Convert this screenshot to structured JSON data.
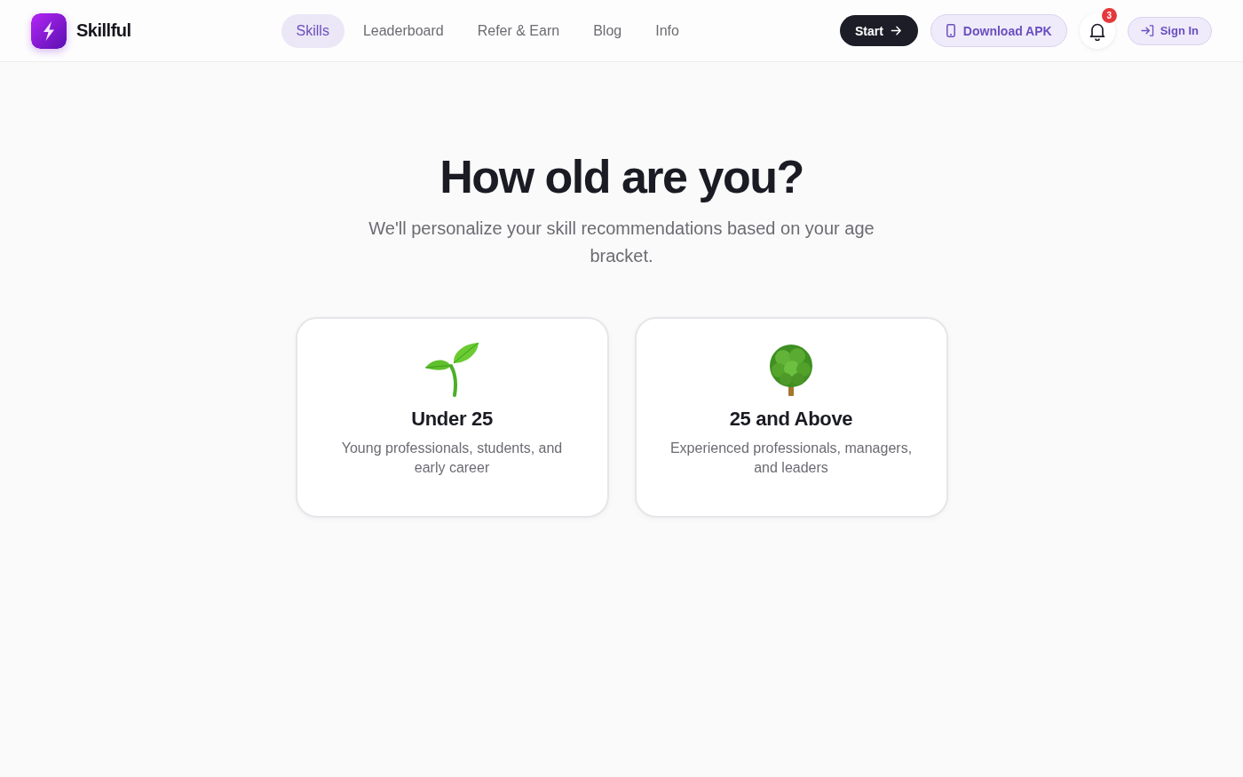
{
  "header": {
    "brand": "Skillful",
    "nav": [
      {
        "label": "Skills",
        "selected": true
      },
      {
        "label": "Leaderboard",
        "selected": false
      },
      {
        "label": "Refer & Earn",
        "selected": false
      },
      {
        "label": "Blog",
        "selected": false
      },
      {
        "label": "Info",
        "selected": false
      }
    ],
    "start_button": "Start",
    "download_button": "Download APK",
    "notifications": {
      "badge": "3"
    },
    "sign_in_button": "Sign In"
  },
  "main": {
    "title": "How old are you?",
    "subtitle": "We'll personalize your skill recommendations based on your age bracket.",
    "options": [
      {
        "title": "Under 25",
        "description": "Young professionals, students, and early career",
        "selected": false
      },
      {
        "title": "25 and Above",
        "description": "Experienced professionals, managers, and leaders",
        "selected": false
      }
    ]
  }
}
